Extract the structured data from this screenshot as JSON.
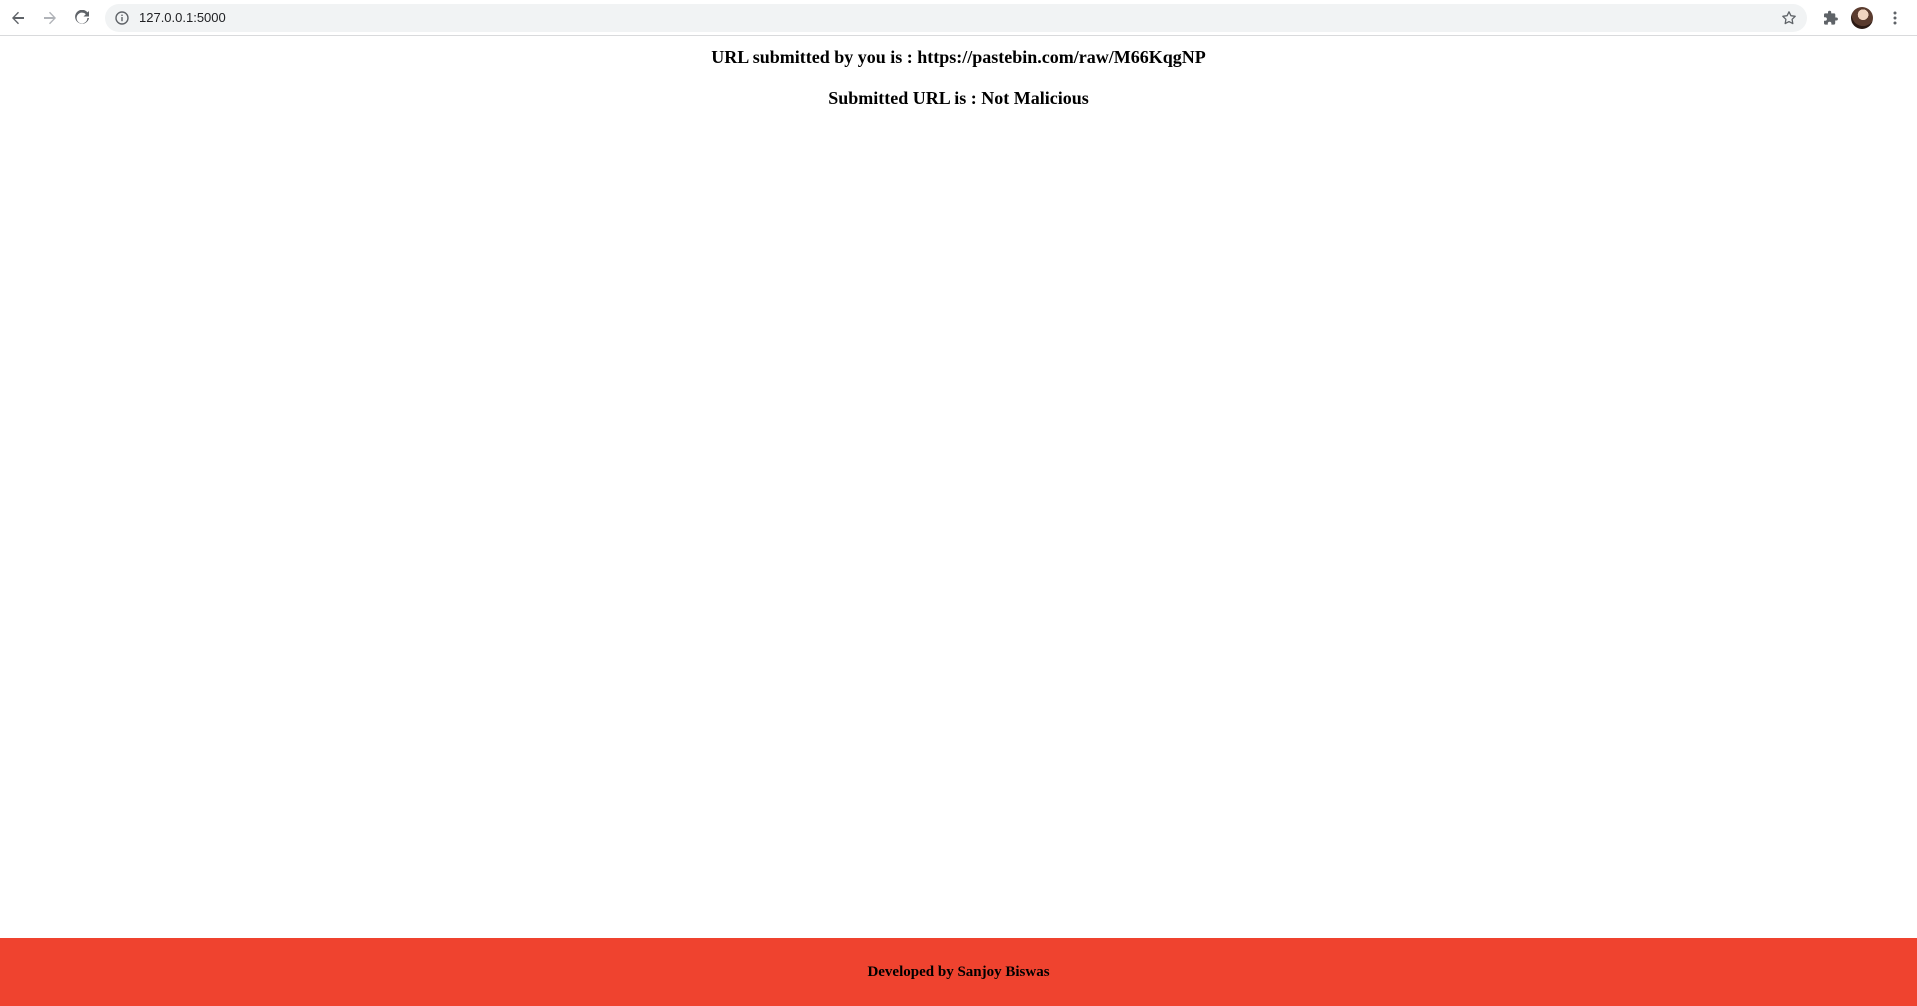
{
  "browser": {
    "url": "127.0.0.1:5000",
    "icons": {
      "back": "arrow-left-icon",
      "forward": "arrow-right-icon",
      "reload": "reload-icon",
      "site_info": "info-icon",
      "bookmark": "star-icon",
      "extensions": "puzzle-icon",
      "profile": "avatar",
      "menu": "kebab-menu-icon"
    }
  },
  "main": {
    "submitted_line": "URL submitted by you is : https://pastebin.com/raw/M66KqgNP",
    "result_line": "Submitted URL is : Not Malicious"
  },
  "footer": {
    "text": "Developed by Sanjoy Biswas",
    "background_color": "#ef432f"
  }
}
